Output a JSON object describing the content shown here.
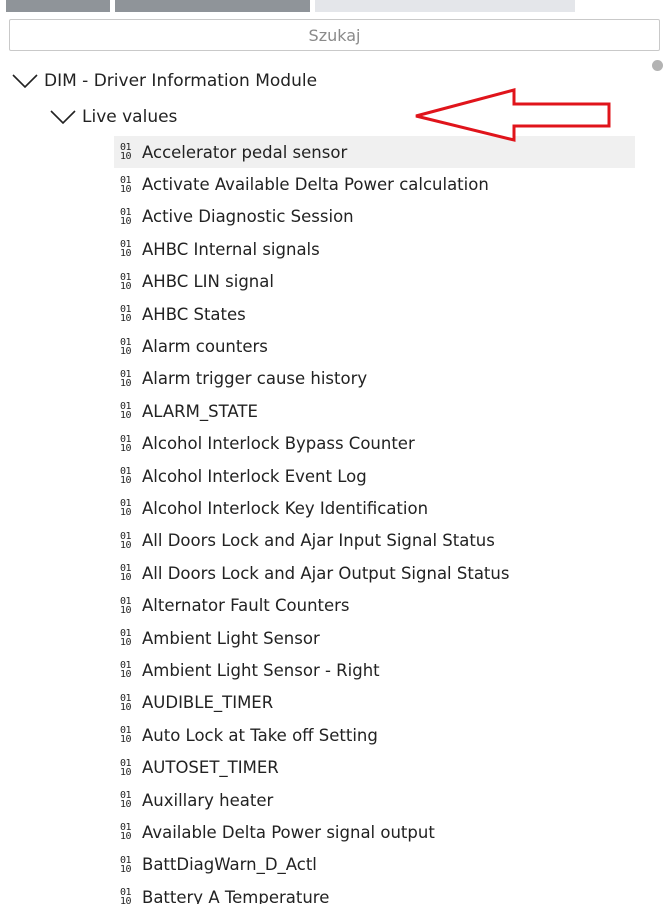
{
  "search": {
    "placeholder": "Szukaj"
  },
  "tree": {
    "root_label": "DIM - Driver Information Module",
    "group_label": "Live values",
    "items": [
      "Accelerator pedal sensor",
      "Activate Available Delta Power calculation",
      "Active Diagnostic Session",
      "AHBC Internal signals",
      "AHBC LIN signal",
      "AHBC States",
      "Alarm counters",
      "Alarm trigger cause history",
      "ALARM_STATE",
      "Alcohol Interlock Bypass Counter",
      "Alcohol Interlock Event Log",
      "Alcohol Interlock Key Identification",
      "All Doors Lock and Ajar Input Signal Status",
      "All Doors Lock and Ajar Output Signal Status",
      "Alternator Fault Counters",
      "Ambient Light Sensor",
      "Ambient Light Sensor - Right",
      "AUDIBLE_TIMER",
      "Auto Lock at Take off Setting",
      "AUTOSET_TIMER",
      "Auxillary heater",
      "Available Delta Power signal output",
      "BattDiagWarn_D_Actl",
      "Battery A Temperature"
    ],
    "item_icon_top": "01",
    "item_icon_bottom": "10"
  },
  "annotation": {
    "arrow_color": "#e0141b"
  }
}
